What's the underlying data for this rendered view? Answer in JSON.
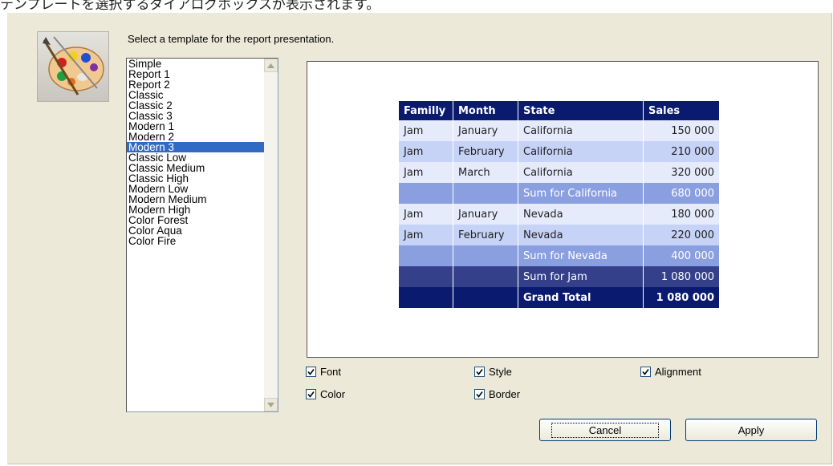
{
  "caption": "テンプレートを選択するダイアログボックスが表示されます。",
  "dialog": {
    "prompt": "Select a template for the report presentation.",
    "templates": [
      "Simple",
      "Report 1",
      "Report 2",
      "Classic",
      "Classic 2",
      "Classic 3",
      "Modern 1",
      "Modern 2",
      "Modern 3",
      "Classic Low",
      "Classic Medium",
      "Classic High",
      "Modern Low",
      "Modern Medium",
      "Modern High",
      "Color Forest",
      "Color Aqua",
      "Color Fire"
    ],
    "selected_template": "Modern 3",
    "preview": {
      "headers": {
        "family": "Familly",
        "month": "Month",
        "state": "State",
        "sales": "Sales"
      },
      "rows": [
        {
          "family": "Jam",
          "month": "January",
          "state": "California",
          "sales": "150 000"
        },
        {
          "family": "Jam",
          "month": "February",
          "state": "California",
          "sales": "210 000"
        },
        {
          "family": "Jam",
          "month": "March",
          "state": "California",
          "sales": "320 000"
        },
        {
          "family": "",
          "month": "",
          "state": "Sum for California",
          "sales": "680 000"
        },
        {
          "family": "Jam",
          "month": "January",
          "state": "Nevada",
          "sales": "180 000"
        },
        {
          "family": "Jam",
          "month": "February",
          "state": "Nevada",
          "sales": "220 000"
        },
        {
          "family": "",
          "month": "",
          "state": "Sum for Nevada",
          "sales": "400 000"
        },
        {
          "family": "",
          "month": "",
          "state": "Sum for Jam",
          "sales": "1 080 000"
        },
        {
          "family": "",
          "month": "",
          "state": "Grand Total",
          "sales": "1 080 000"
        }
      ]
    },
    "options": {
      "font": "Font",
      "color": "Color",
      "style": "Style",
      "border": "Border",
      "alignment": "Alignment"
    },
    "buttons": {
      "cancel": "Cancel",
      "apply": "Apply"
    }
  }
}
